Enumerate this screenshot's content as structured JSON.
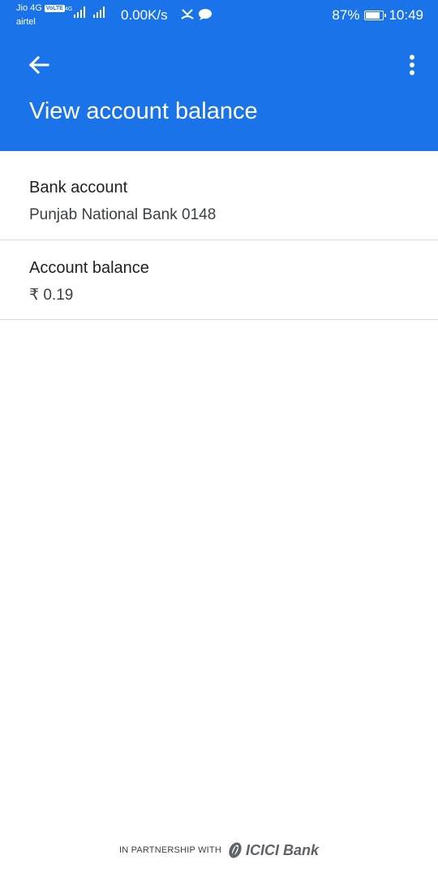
{
  "status_bar": {
    "carrier_primary": "Jio 4G",
    "volte_badge": "VoLTE",
    "carrier_secondary": "airtel",
    "network_type": "4G",
    "net_speed": "0.00K/s",
    "battery_percent": "87%",
    "battery_level": 0.87,
    "time": "10:49"
  },
  "app_bar": {
    "title": "View account balance",
    "back_icon": "arrow-left-icon",
    "menu_icon": "more-vert-icon"
  },
  "details": [
    {
      "label": "Bank account",
      "value": "Punjab National Bank 0148"
    },
    {
      "label": "Account balance",
      "value": "₹ 0.19"
    }
  ],
  "footer": {
    "partnership_text": "IN PARTNERSHIP WITH",
    "partner_logo": "ICICI Bank"
  },
  "colors": {
    "primary": "#1a73e8",
    "divider": "#dadce0"
  }
}
